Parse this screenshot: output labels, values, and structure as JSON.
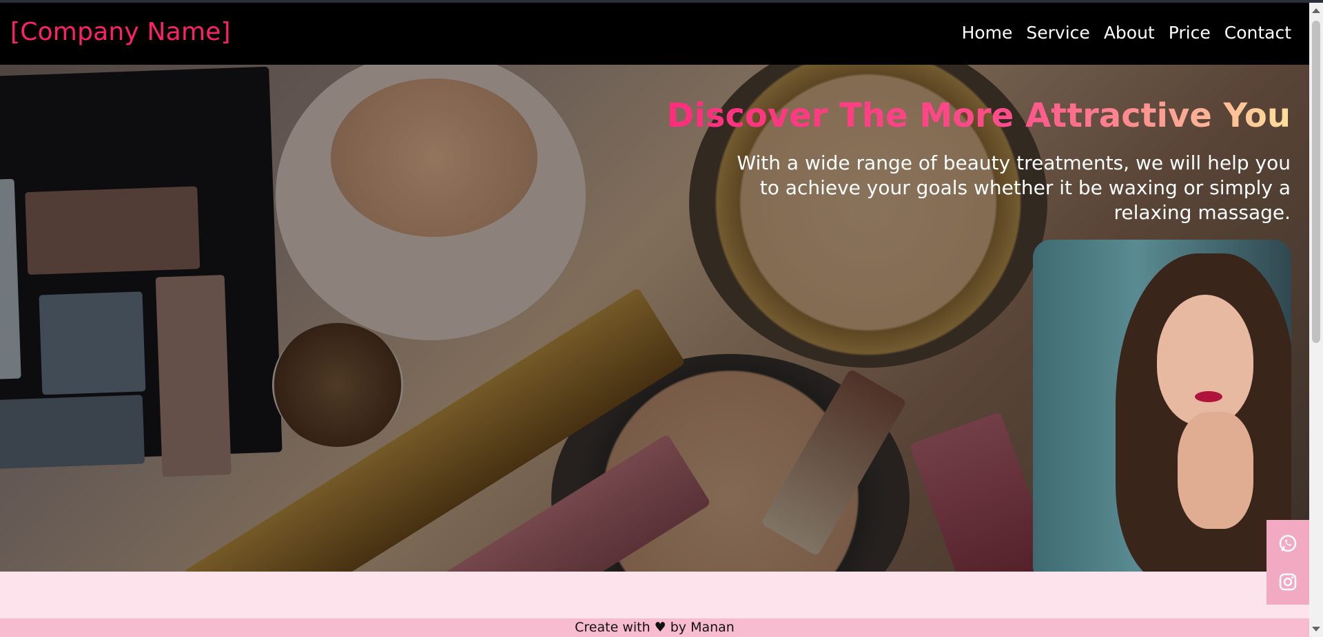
{
  "header": {
    "brand": "[Company Name]",
    "nav": [
      "Home",
      "Service",
      "About",
      "Price",
      "Contact"
    ]
  },
  "hero": {
    "title": "Discover The More Attractive You",
    "text": "With a wide range of beauty treatments, we will help you to achieve your goals whether it be waxing or simply a relaxing massage."
  },
  "social": {
    "icons": [
      "whatsapp-icon",
      "instagram-icon"
    ]
  },
  "footer": {
    "text": "Create with ♥ by Manan"
  },
  "colors": {
    "brand": "#ff1f6b",
    "navbar": "#000000",
    "footer": "#f8bcd0",
    "content_bg": "#fde4ec",
    "social_bg": "#f2a9c2"
  }
}
